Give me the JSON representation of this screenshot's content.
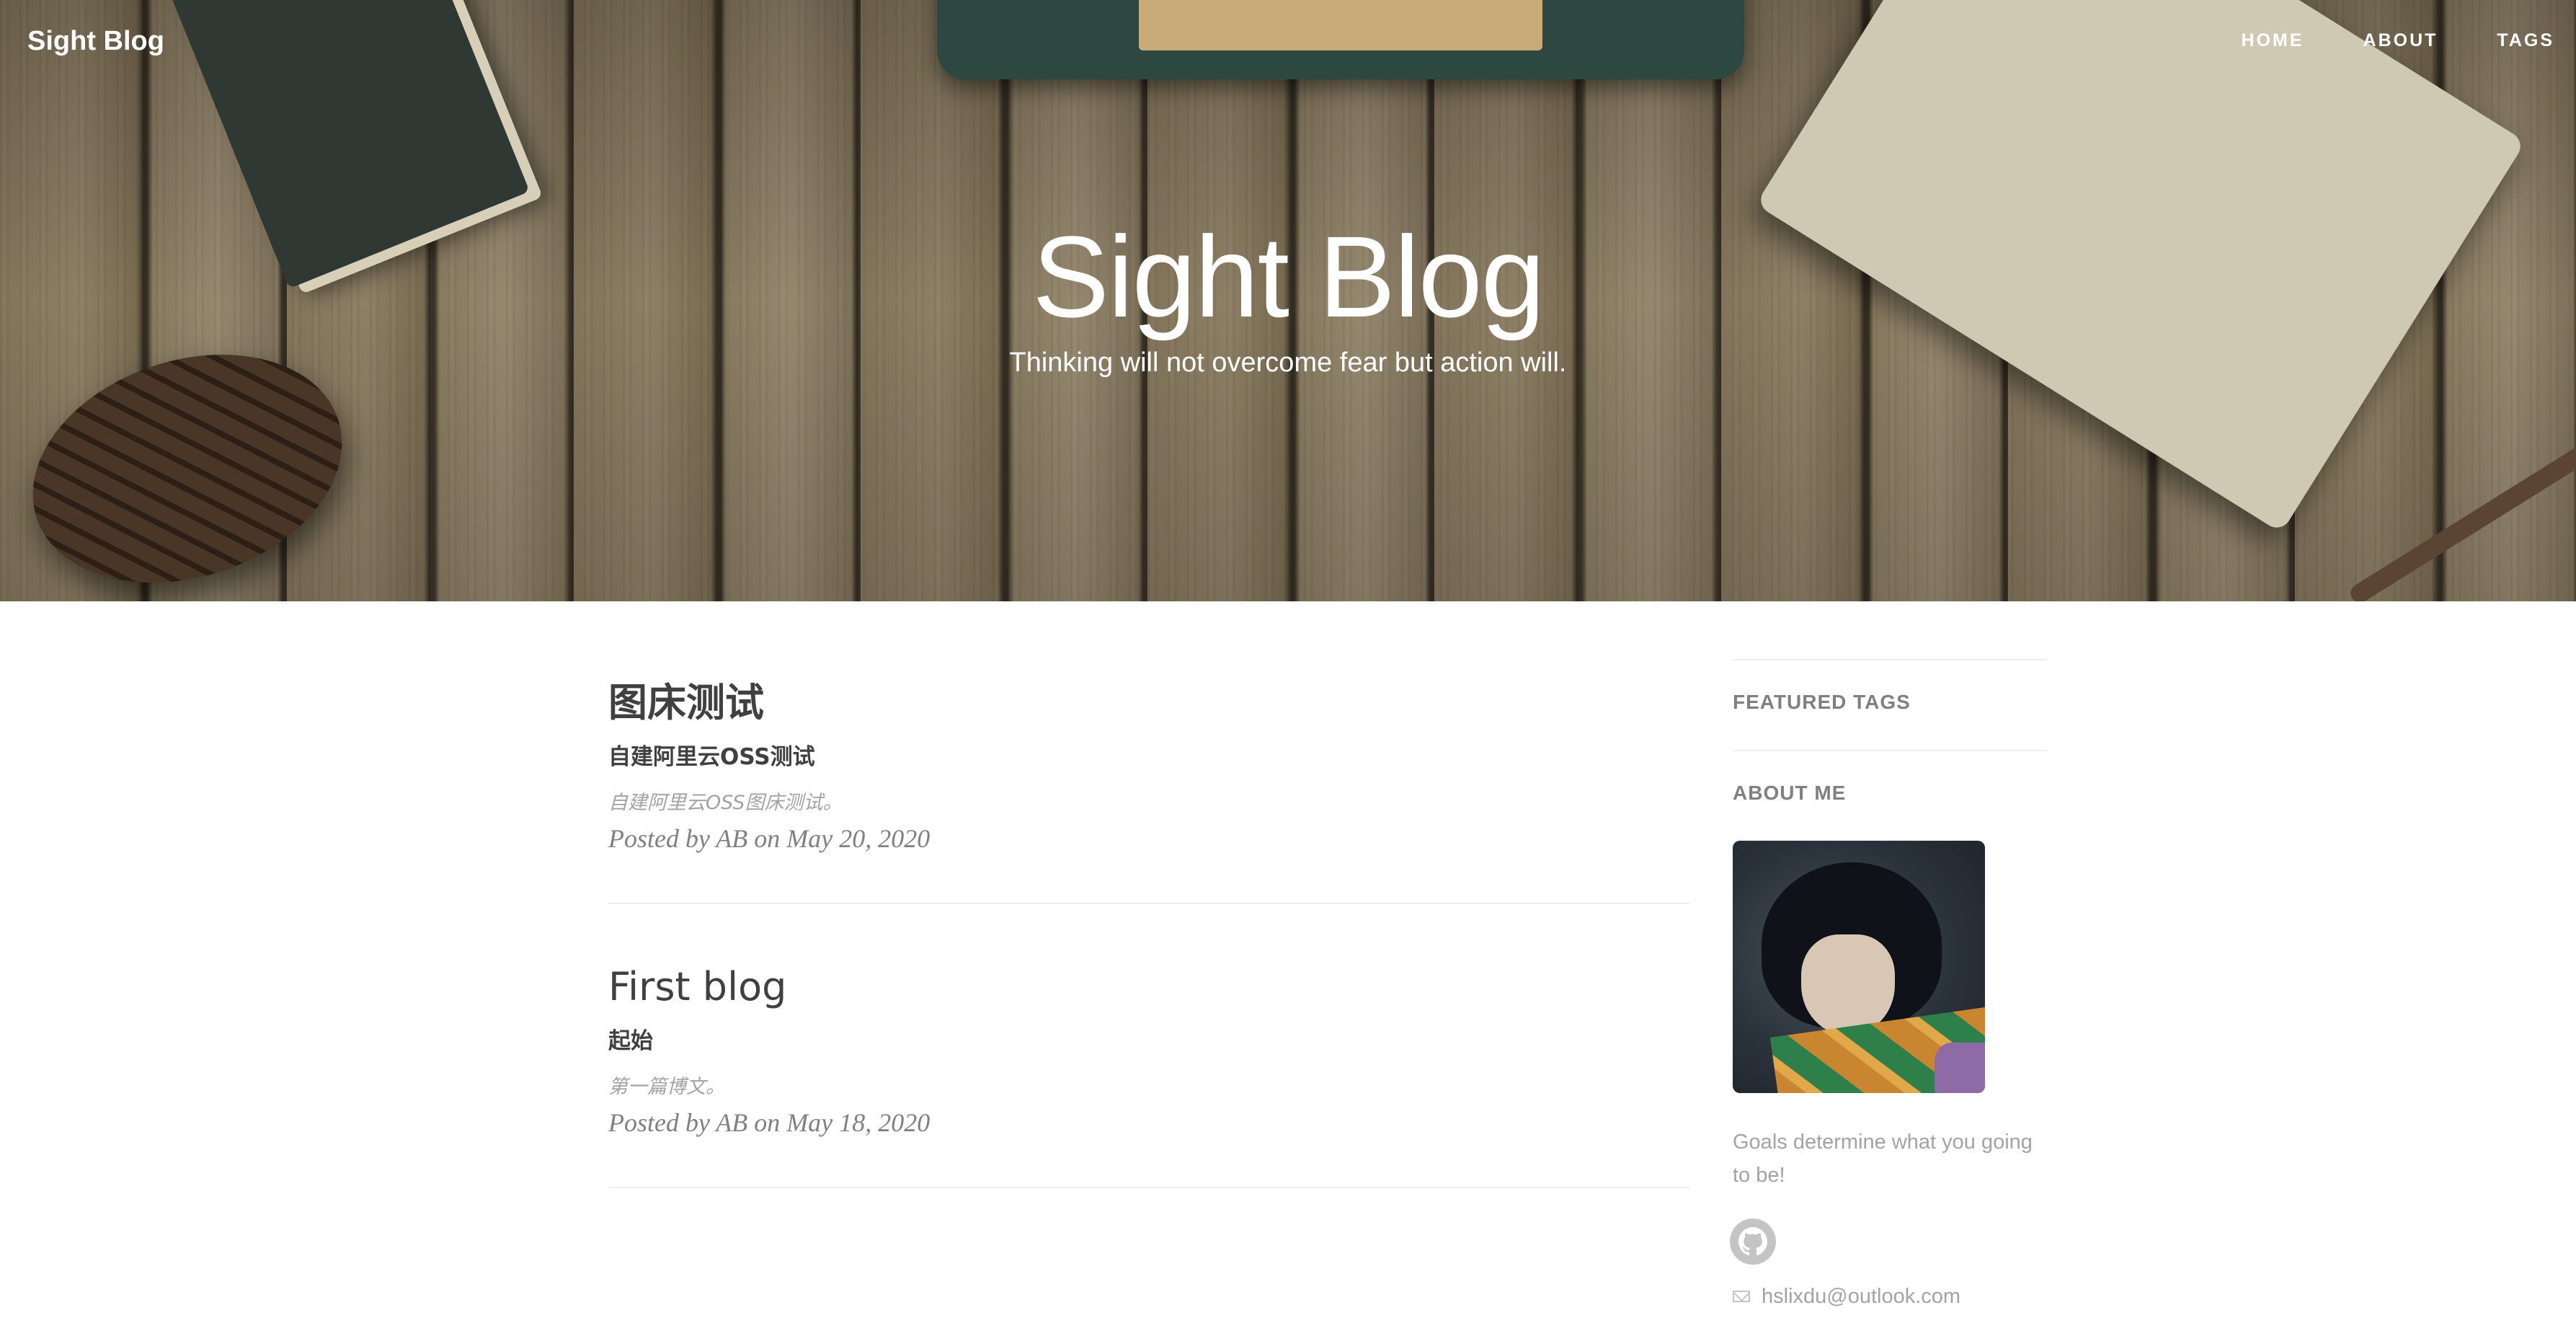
{
  "navbar": {
    "brand": "Sight Blog",
    "links": [
      "HOME",
      "ABOUT",
      "TAGS"
    ]
  },
  "hero": {
    "title": "Sight Blog",
    "subtitle": "Thinking will not overcome fear but action will."
  },
  "posts": [
    {
      "title": "图床测试",
      "subtitle": "自建阿里云OSS测试",
      "excerpt": "自建阿里云OSS图床测试。",
      "meta": "Posted by AB on May 20, 2020"
    },
    {
      "title": "First blog",
      "subtitle": "起始",
      "excerpt": "第一篇博文。",
      "meta": "Posted by AB on May 18, 2020"
    }
  ],
  "sidebar": {
    "featured_tags_heading": "FEATURED TAGS",
    "about_heading": "ABOUT ME",
    "about_text": "Goals determine what you going to be!",
    "email": "hslixdu@outlook.com",
    "icons": {
      "github": "github-icon",
      "email": "mail-icon"
    }
  },
  "colors": {
    "text": "#404040",
    "muted": "#a3a3a3",
    "meta": "#808080",
    "divider": "#eeeeee",
    "nav_text": "#ffffff"
  }
}
